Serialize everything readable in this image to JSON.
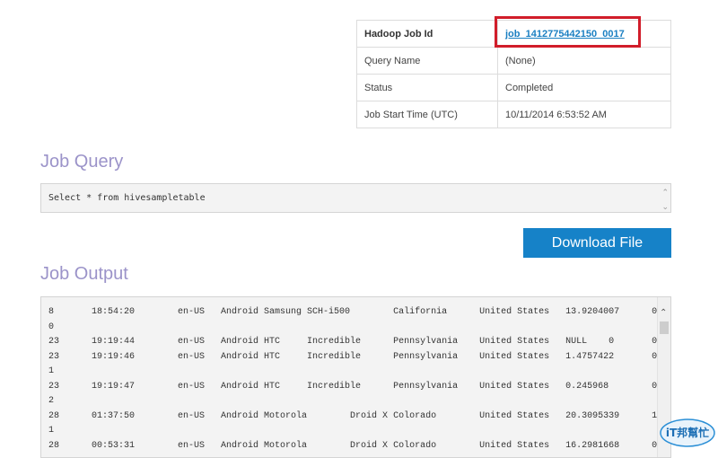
{
  "job_info": {
    "rows": [
      {
        "key": "Hadoop Job Id",
        "value": "job_1412775442150_0017"
      },
      {
        "key": "Query Name",
        "value": "(None)"
      },
      {
        "key": "Status",
        "value": "Completed"
      },
      {
        "key": "Job Start Time (UTC)",
        "value": "10/11/2014 6:53:52 AM"
      }
    ]
  },
  "job_query": {
    "title": "Job Query",
    "text": "Select * from hivesampletable"
  },
  "download_button": {
    "label": "Download File"
  },
  "job_output": {
    "title": "Job Output",
    "text": "8       18:54:20        en-US   Android Samsung SCH-i500        California      United States   13.9204007      0\n0\n23      19:19:44        en-US   Android HTC     Incredible      Pennsylvania    United States   NULL    0       0\n23      19:19:46        en-US   Android HTC     Incredible      Pennsylvania    United States   1.4757422       0\n1\n23      19:19:47        en-US   Android HTC     Incredible      Pennsylvania    United States   0.245968        0\n2\n28      01:37:50        en-US   Android Motorola        Droid X Colorado        United States   20.3095339      1\n1\n28      00:53:31        en-US   Android Motorola        Droid X Colorado        United States   16.2981668      0"
  },
  "watermark": {
    "text": "iT邦幫忙"
  },
  "colors": {
    "accent_blue": "#1682c8",
    "link_blue": "#1a7fc2",
    "highlight_red": "#d11d2a",
    "section_title": "#9b93c9"
  }
}
